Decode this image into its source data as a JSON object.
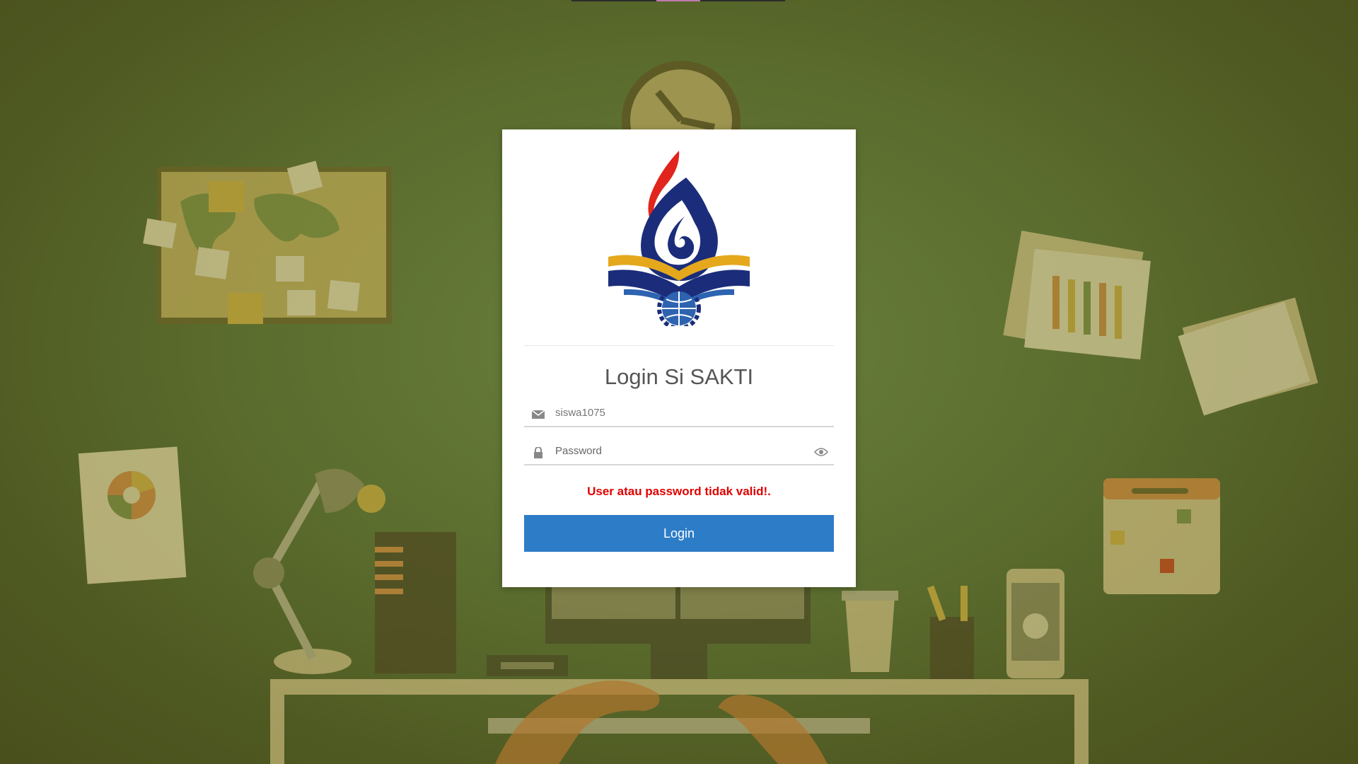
{
  "colors": {
    "background": "#5b6d2e",
    "card": "#ffffff",
    "button": "#2d7cc7",
    "error": "#e00000"
  },
  "login": {
    "title": "Login Si SAKTI",
    "username": {
      "value": "siswa1075",
      "icon": "envelope-icon"
    },
    "password": {
      "placeholder": "Password",
      "value": "",
      "icon": "lock-icon",
      "toggle_icon": "eye-icon"
    },
    "error_message": "User atau password tidak valid!.",
    "button_label": "Login"
  }
}
